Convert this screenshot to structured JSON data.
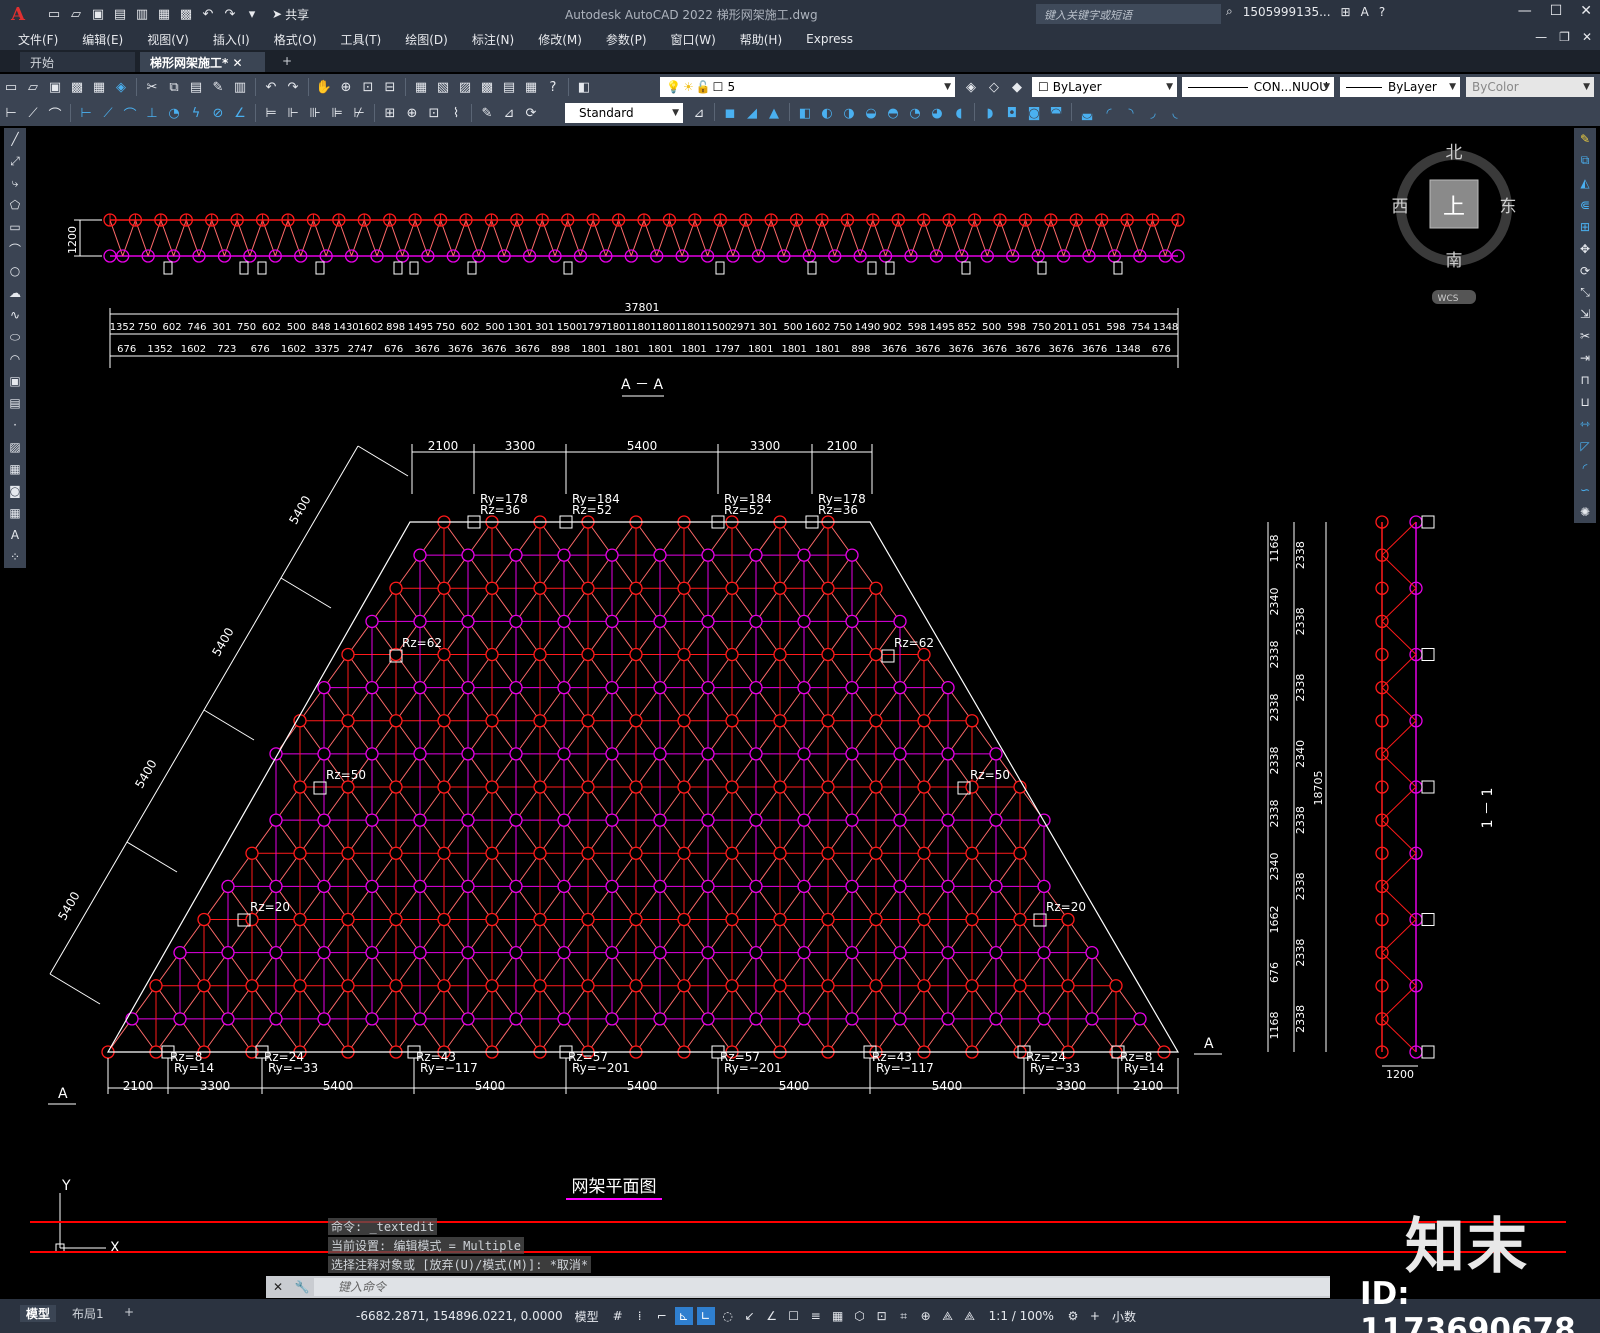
{
  "window": {
    "app_logo": "A",
    "title": "Autodesk AutoCAD 2022    梯形网架施工.dwg",
    "search_placeholder": "键入关键字或短语",
    "user": "1505999135...",
    "share_label": "共享"
  },
  "menu": [
    "文件(F)",
    "编辑(E)",
    "视图(V)",
    "插入(I)",
    "格式(O)",
    "工具(T)",
    "绘图(D)",
    "标注(N)",
    "修改(M)",
    "参数(P)",
    "窗口(W)",
    "帮助(H)",
    "Express"
  ],
  "tabs": {
    "start": "开始",
    "active": "梯形网架施工*"
  },
  "toolbar": {
    "layer_value": "5",
    "color_value": "ByLayer",
    "linetype_value": "CON...NUOU",
    "lineweight_value": "ByLayer",
    "plotstyle_value": "ByColor",
    "textstyle_value": "Standard"
  },
  "viewcube": {
    "north": "北",
    "south": "南",
    "east": "东",
    "west": "西",
    "top": "上",
    "wcs": "WCS"
  },
  "drawing": {
    "section_aa": {
      "height_dim": "1200",
      "total": "37801",
      "top_row": [
        "1352",
        "750",
        "602",
        "746",
        "301",
        "750",
        "602",
        "500",
        "848",
        "1430",
        "1602",
        "898",
        "1495",
        "750",
        "602",
        "500",
        "1301",
        "301",
        "1500",
        "1797",
        "1801",
        "1801",
        "1801",
        "1801",
        "1500",
        "2971",
        "301",
        "500",
        "1602",
        "750",
        "1490",
        "902",
        "598",
        "1495",
        "852",
        "500",
        "598",
        "750",
        "2011",
        "051",
        "598",
        "754",
        "1348"
      ],
      "bottom_row": [
        "676",
        "1352",
        "1602",
        "723",
        "676",
        "1602",
        "3375",
        "2747",
        "676",
        "3676",
        "3676",
        "3676",
        "3676",
        "898",
        "1801",
        "1801",
        "1801",
        "1801",
        "1797",
        "1801",
        "1801",
        "1801",
        "898",
        "3676",
        "3676",
        "3676",
        "3676",
        "3676",
        "3676",
        "3676",
        "1348",
        "676"
      ],
      "title": "A － A"
    },
    "plan": {
      "top_dims": [
        "2100",
        "3300",
        "5400",
        "3300",
        "2100"
      ],
      "bottom_dims": [
        "2100",
        "3300",
        "5400",
        "5400",
        "5400",
        "5400",
        "5400",
        "3300",
        "2100"
      ],
      "slant_dims": [
        "5400",
        "5400",
        "5400",
        "5400"
      ],
      "top_supports": [
        {
          "ry": "Ry=178",
          "rz": "Rz=36"
        },
        {
          "ry": "Ry=184",
          "rz": "Rz=52"
        },
        {
          "ry": "Ry=184",
          "rz": "Rz=52"
        },
        {
          "ry": "Ry=178",
          "rz": "Rz=36"
        }
      ],
      "side_supports": [
        "Rz=62",
        "Rz=62",
        "Rz=50",
        "Rz=50",
        "Rz=20",
        "Rz=20"
      ],
      "bottom_supports": [
        {
          "rz": "Rz=8",
          "ry": "Ry=14"
        },
        {
          "rz": "Rz=24",
          "ry": "Ry=−33"
        },
        {
          "rz": "Rz=43",
          "ry": "Ry=−117"
        },
        {
          "rz": "Rz=57",
          "ry": "Ry=−201"
        },
        {
          "rz": "Rz=57",
          "ry": "Ry=−201"
        },
        {
          "rz": "Rz=43",
          "ry": "Ry=−117"
        },
        {
          "rz": "Rz=24",
          "ry": "Ry=−33"
        },
        {
          "rz": "Rz=8",
          "ry": "Ry=14"
        }
      ],
      "section_mark": "A",
      "title": "网架平面图"
    },
    "section_11": {
      "left_dims": [
        "1168",
        "2340",
        "2338",
        "2338",
        "2338",
        "2338",
        "2340",
        "1662",
        "676",
        "1168"
      ],
      "right_dims": [
        "2338",
        "2338",
        "2338",
        "2340",
        "2338",
        "2338",
        "2338",
        "2338"
      ],
      "total": "18705",
      "width": "1200",
      "title": "1 － 1"
    }
  },
  "ucs": {
    "y": "Y",
    "x": "X"
  },
  "command": {
    "history": [
      "命令: _textedit",
      "当前设置: 编辑模式 = Multiple",
      "选择注释对象或 [放弃(U)/模式(M)]: *取消*"
    ],
    "placeholder": "键入命令"
  },
  "layout_tabs": [
    "模型",
    "布局1"
  ],
  "status": {
    "coords": "-6682.2871, 154896.0221, 0.0000",
    "model": "模型",
    "scale": "1:1 / 100%",
    "units": "小数"
  },
  "watermark": {
    "brand": "知末",
    "id": "ID: 1173690678"
  }
}
